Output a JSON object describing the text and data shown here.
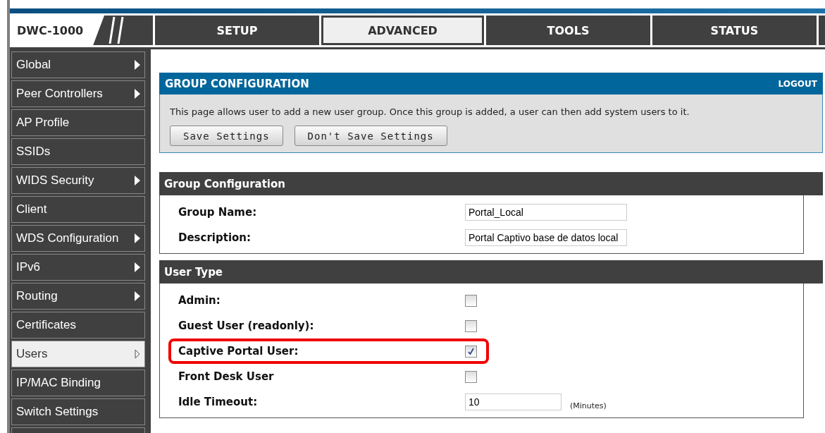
{
  "logo": {
    "text": "DWC-1000"
  },
  "tabs": [
    {
      "label": "SETUP",
      "selected": false
    },
    {
      "label": "ADVANCED",
      "selected": true
    },
    {
      "label": "TOOLS",
      "selected": false
    },
    {
      "label": "STATUS",
      "selected": false
    }
  ],
  "sidebar": {
    "items": [
      {
        "label": "Global",
        "submenu": true,
        "selected": false
      },
      {
        "label": "Peer Controllers",
        "submenu": true,
        "selected": false
      },
      {
        "label": "AP Profile",
        "submenu": false,
        "selected": false
      },
      {
        "label": "SSIDs",
        "submenu": false,
        "selected": false
      },
      {
        "label": "WIDS Security",
        "submenu": true,
        "selected": false
      },
      {
        "label": "Client",
        "submenu": false,
        "selected": false
      },
      {
        "label": "WDS Configuration",
        "submenu": true,
        "selected": false
      },
      {
        "label": "IPv6",
        "submenu": true,
        "selected": false
      },
      {
        "label": "Routing",
        "submenu": true,
        "selected": false
      },
      {
        "label": "Certificates",
        "submenu": false,
        "selected": false
      },
      {
        "label": "Users",
        "submenu": true,
        "selected": true
      },
      {
        "label": "IP/MAC Binding",
        "submenu": false,
        "selected": false
      },
      {
        "label": "Switch Settings",
        "submenu": false,
        "selected": false
      }
    ]
  },
  "page": {
    "title": "GROUP CONFIGURATION",
    "logout": "LOGOUT",
    "description": "This page allows user to add a new user group. Once this group is added, a user can then add system users to it.",
    "buttons": [
      "Save Settings",
      "Don't Save Settings"
    ]
  },
  "sections": [
    {
      "title": "Group Configuration",
      "rows": [
        {
          "kind": "text",
          "label": "Group Name:",
          "value": "Portal_Local",
          "highlighted": false
        },
        {
          "kind": "text",
          "label": "Description:",
          "value": "Portal Captivo base de datos local",
          "highlighted": false
        }
      ]
    },
    {
      "title": "User Type",
      "rows": [
        {
          "kind": "checkbox",
          "label": "Admin:",
          "checked": false,
          "highlighted": false
        },
        {
          "kind": "checkbox",
          "label": "Guest User (readonly):",
          "checked": false,
          "highlighted": false
        },
        {
          "kind": "checkbox",
          "label": "Captive Portal User:",
          "checked": true,
          "highlighted": true
        },
        {
          "kind": "checkbox",
          "label": "Front Desk User",
          "checked": false,
          "highlighted": false
        },
        {
          "kind": "text",
          "label": "Idle Timeout:",
          "value": "10",
          "unit": "(Minutes)",
          "highlighted": false
        }
      ]
    }
  ]
}
